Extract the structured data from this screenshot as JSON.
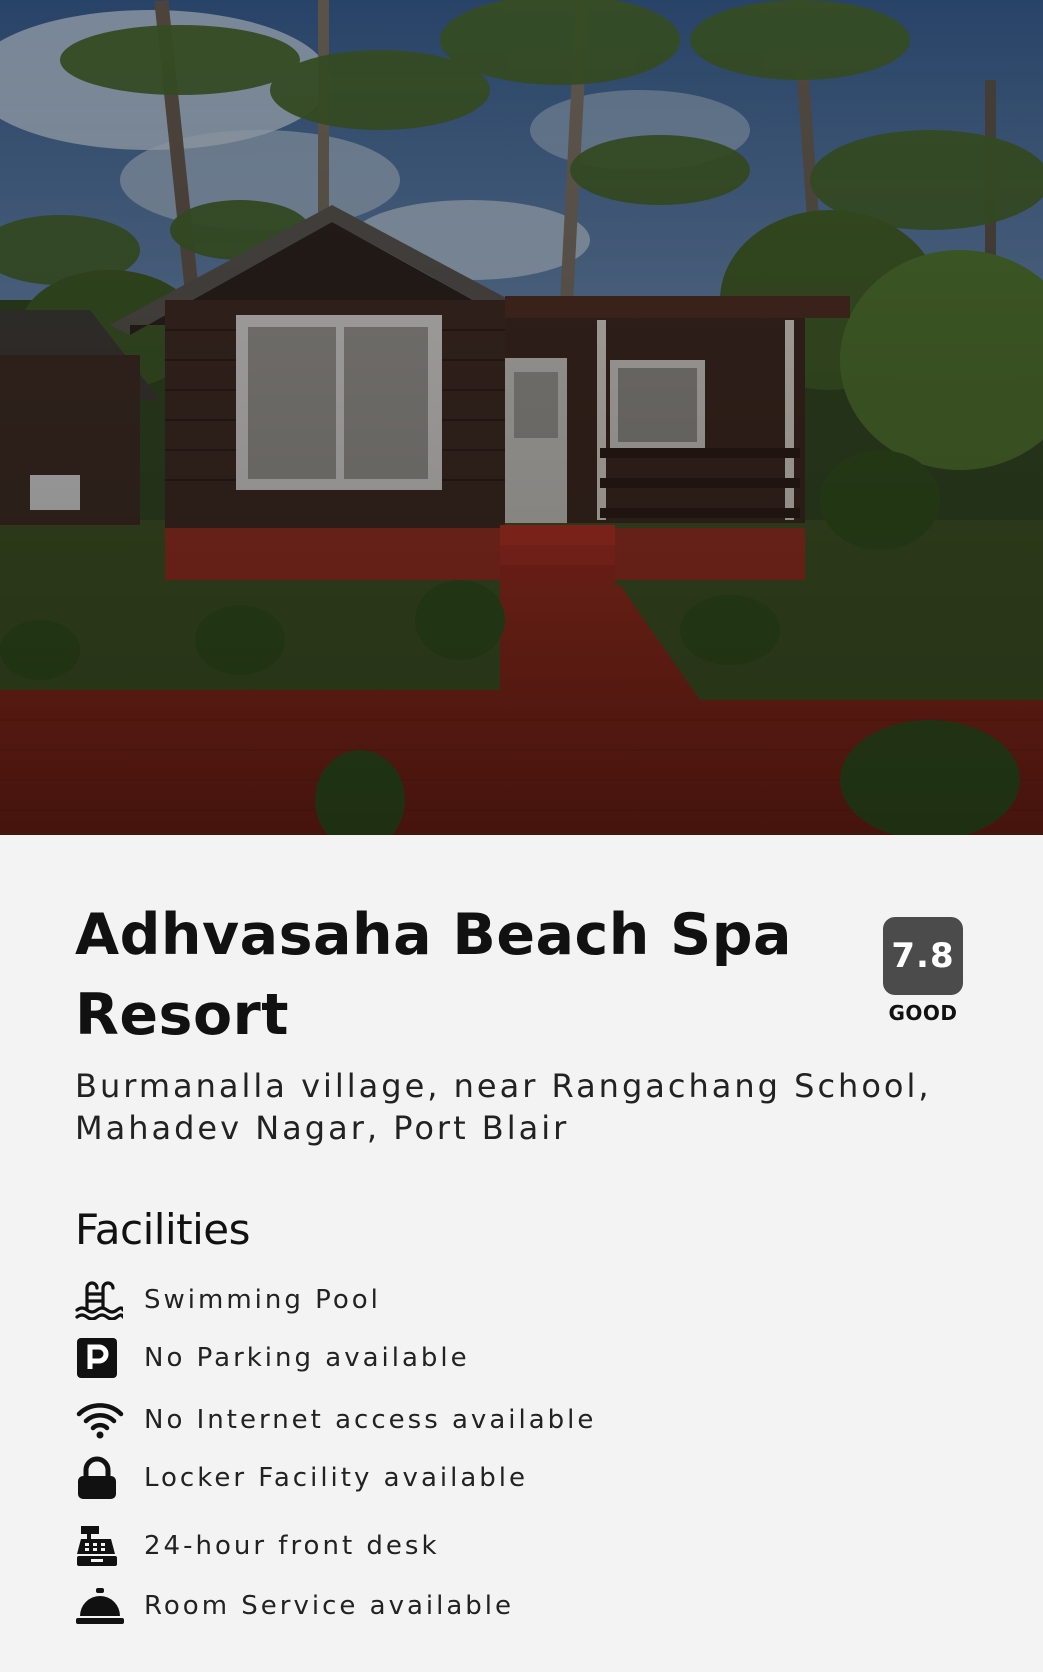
{
  "hero": {
    "image_icon": "resort-cottage-photo"
  },
  "hotel": {
    "name": "Adhvasaha Beach Spa Resort",
    "address": "Burmanalla village, near Rangachang School, Mahadev Nagar, Port Blair",
    "rating": {
      "score": "7.8",
      "label": "GOOD",
      "color": "#4b4b4b"
    }
  },
  "facilities": {
    "title": "Facilities",
    "items": [
      {
        "icon": "swimming-pool-icon",
        "label": "Swimming Pool"
      },
      {
        "icon": "parking-icon",
        "label": "No Parking available"
      },
      {
        "icon": "wifi-icon",
        "label": "No Internet access available"
      },
      {
        "icon": "lock-icon",
        "label": "Locker Facility available"
      },
      {
        "icon": "cash-register-icon",
        "label": "24-hour front desk"
      },
      {
        "icon": "service-bell-icon",
        "label": "Room Service available"
      }
    ]
  }
}
